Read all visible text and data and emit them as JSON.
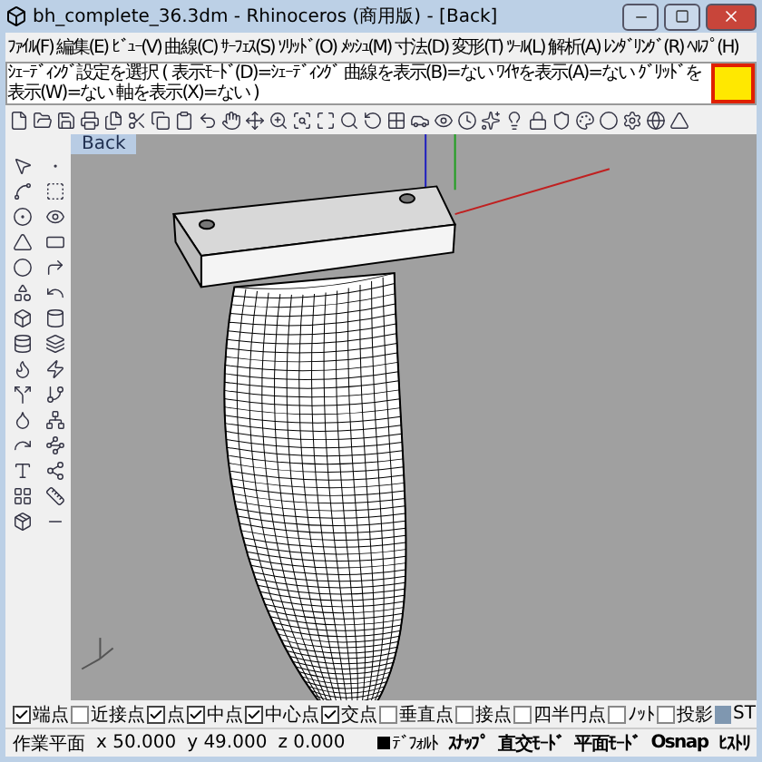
{
  "window": {
    "title": "bh_complete_36.3dm - Rhinoceros (商用版) - [Back]"
  },
  "menu": [
    "ﾌｧｲﾙ(F)",
    "編集(E)",
    "ﾋﾞｭｰ(V)",
    "曲線(C)",
    "ｻｰﾌｪｽ(S)",
    "ｿﾘｯﾄﾞ(O)",
    "ﾒｯｼｭ(M)",
    "寸法(D)",
    "変形(T)",
    "ﾂｰﾙ(L)",
    "解析(A)",
    "ﾚﾝﾀﾞﾘﾝｸﾞ(R)",
    "ﾍﾙﾌﾟ(H)"
  ],
  "command": {
    "prompt": "ｼｪｰﾃﾞｨﾝｸﾞ設定を選択 ( 表示ﾓｰﾄﾞ(D)=ｼｪｰﾃﾞｨﾝｸﾞ 曲線を表示(B)=ない ﾜｲﾔを表示(A)=ない ｸﾞﾘｯﾄﾞを表示(W)=ない 軸を表示(X)=ない )"
  },
  "viewport": {
    "tab": "Back"
  },
  "osnap": [
    {
      "label": "端点",
      "checked": true
    },
    {
      "label": "近接点",
      "checked": false
    },
    {
      "label": "点",
      "checked": true
    },
    {
      "label": "中点",
      "checked": true
    },
    {
      "label": "中心点",
      "checked": true
    },
    {
      "label": "交点",
      "checked": true
    },
    {
      "label": "垂直点",
      "checked": false
    },
    {
      "label": "接点",
      "checked": false
    },
    {
      "label": "四半円点",
      "checked": false
    },
    {
      "label": "ﾉｯﾄ",
      "checked": false
    },
    {
      "label": "投影",
      "checked": false
    }
  ],
  "osnap_extra": "ST",
  "status_bar": {
    "plane": "作業平面",
    "x": "x 50.000",
    "y": "y 49.000",
    "z": "z 0.000",
    "layer": "ﾃﾞﾌｫﾙﾄ",
    "buttons": [
      "ｽﾅｯﾌﾟ",
      "直交ﾓｰﾄﾞ",
      "平面ﾓｰﾄﾞ",
      "Osnap",
      "ﾋｽﾄﾘ"
    ]
  }
}
